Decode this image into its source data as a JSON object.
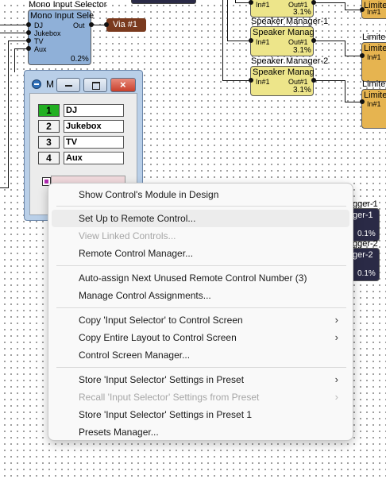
{
  "canvas": {
    "input_selector": {
      "title": "Mono Input Selector",
      "header": "Mono Input Sele",
      "inputs": [
        "DJ",
        "Jukebox",
        "TV",
        "Aux"
      ],
      "out_label": "Out",
      "percent": "0.2%"
    },
    "via_label": "Via #1",
    "speaker_managers": [
      {
        "title": "",
        "header": "",
        "in_label": "In#1",
        "out_label": "Out#1",
        "percent": "3.1%"
      },
      {
        "title": "Speaker Manager-1",
        "header": "Speaker Manag",
        "in_label": "In#1",
        "out_label": "Out#1",
        "percent": "3.1%"
      },
      {
        "title": "Speaker Manager-2",
        "header": "Speaker Manag",
        "in_label": "In#1",
        "out_label": "Out#1",
        "percent": "3.1%"
      }
    ],
    "limiters": [
      {
        "title": "",
        "header": "Limite",
        "in_label": "In#1"
      },
      {
        "title": "Limiter",
        "header": "Limite",
        "in_label": "In#1"
      },
      {
        "title": "Limiter",
        "header": "Limite",
        "in_label": "In#1"
      }
    ],
    "loggers": [
      {
        "title": "gger-1",
        "header": "ger-1",
        "percent": "0.1%"
      },
      {
        "title": "gger-2",
        "header": "ger-2",
        "percent": "0.1%"
      }
    ]
  },
  "control_window": {
    "title": "M",
    "items": [
      {
        "number": "1",
        "name": "DJ"
      },
      {
        "number": "2",
        "name": "Jukebox"
      },
      {
        "number": "3",
        "name": "TV"
      },
      {
        "number": "4",
        "name": "Aux"
      }
    ]
  },
  "context_menu": {
    "items": [
      {
        "label": "Show Control's Module in Design"
      },
      {
        "label": "Set Up to Remote Control..."
      },
      {
        "label": "View Linked Controls..."
      },
      {
        "label": "Remote Control Manager..."
      },
      {
        "label": "Auto-assign Next Unused Remote Control Number (3)"
      },
      {
        "label": "Manage Control Assignments..."
      },
      {
        "label": "Copy 'Input Selector' to Control Screen"
      },
      {
        "label": "Copy Entire Layout to Control Screen"
      },
      {
        "label": "Control Screen Manager..."
      },
      {
        "label": "Store 'Input Selector' Settings in Preset"
      },
      {
        "label": "Recall 'Input Selector' Settings from Preset"
      },
      {
        "label": "Store 'Input Selector' Settings in Preset 1"
      },
      {
        "label": "Presets Manager..."
      }
    ],
    "submenu_arrow": "›"
  },
  "colors": {
    "input_selector_module": "#8fb0d8",
    "speaker_manager_module": "#ede58a",
    "limiter_module": "#e6b450",
    "logger_module": "#2a2a46",
    "via_label": "#7a3a1e",
    "selected_button": "#22b022",
    "menu_background": "#f9f9f9",
    "menu_highlight": "#ececec",
    "disabled_text": "#a6a6a6"
  }
}
